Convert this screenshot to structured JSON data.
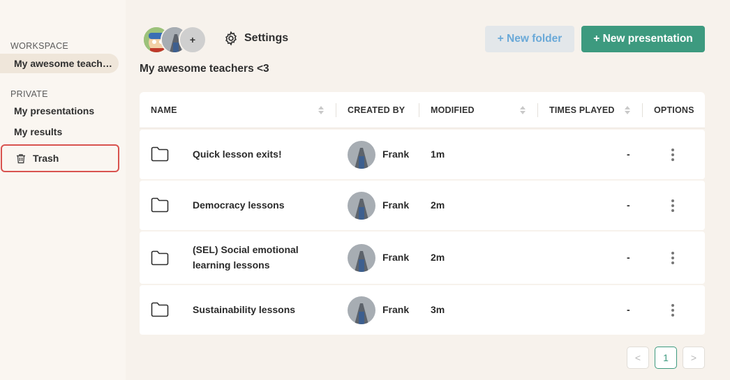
{
  "sidebar": {
    "workspace_heading": "WORKSPACE",
    "workspace_item": "My awesome teache...",
    "private_heading": "PRIVATE",
    "items": [
      {
        "label": "My presentations"
      },
      {
        "label": "My results"
      }
    ],
    "trash_label": "Trash"
  },
  "header": {
    "avatar_plus": "+",
    "settings_label": "Settings",
    "new_folder_label": "+ New folder",
    "new_presentation_label": "+ New presentation",
    "workspace_title": "My awesome teachers <3"
  },
  "table": {
    "columns": [
      "NAME",
      "CREATED BY",
      "MODIFIED",
      "TIMES PLAYED",
      "OPTIONS"
    ],
    "rows": [
      {
        "name": "Quick lesson exits!",
        "created_by": "Frank",
        "modified": "1m",
        "times_played": "-"
      },
      {
        "name": "Democracy lessons",
        "created_by": "Frank",
        "modified": "2m",
        "times_played": "-"
      },
      {
        "name": "(SEL) Social emotional learning lessons",
        "created_by": "Frank",
        "modified": "2m",
        "times_played": "-"
      },
      {
        "name": "Sustainability lessons",
        "created_by": "Frank",
        "modified": "3m",
        "times_played": "-"
      }
    ]
  },
  "pagination": {
    "prev": "<",
    "current": "1",
    "next": ">"
  },
  "colors": {
    "accent": "#3d9a7f",
    "secondary_button_text": "#6aa9d8",
    "highlight_border": "#d9534f"
  }
}
